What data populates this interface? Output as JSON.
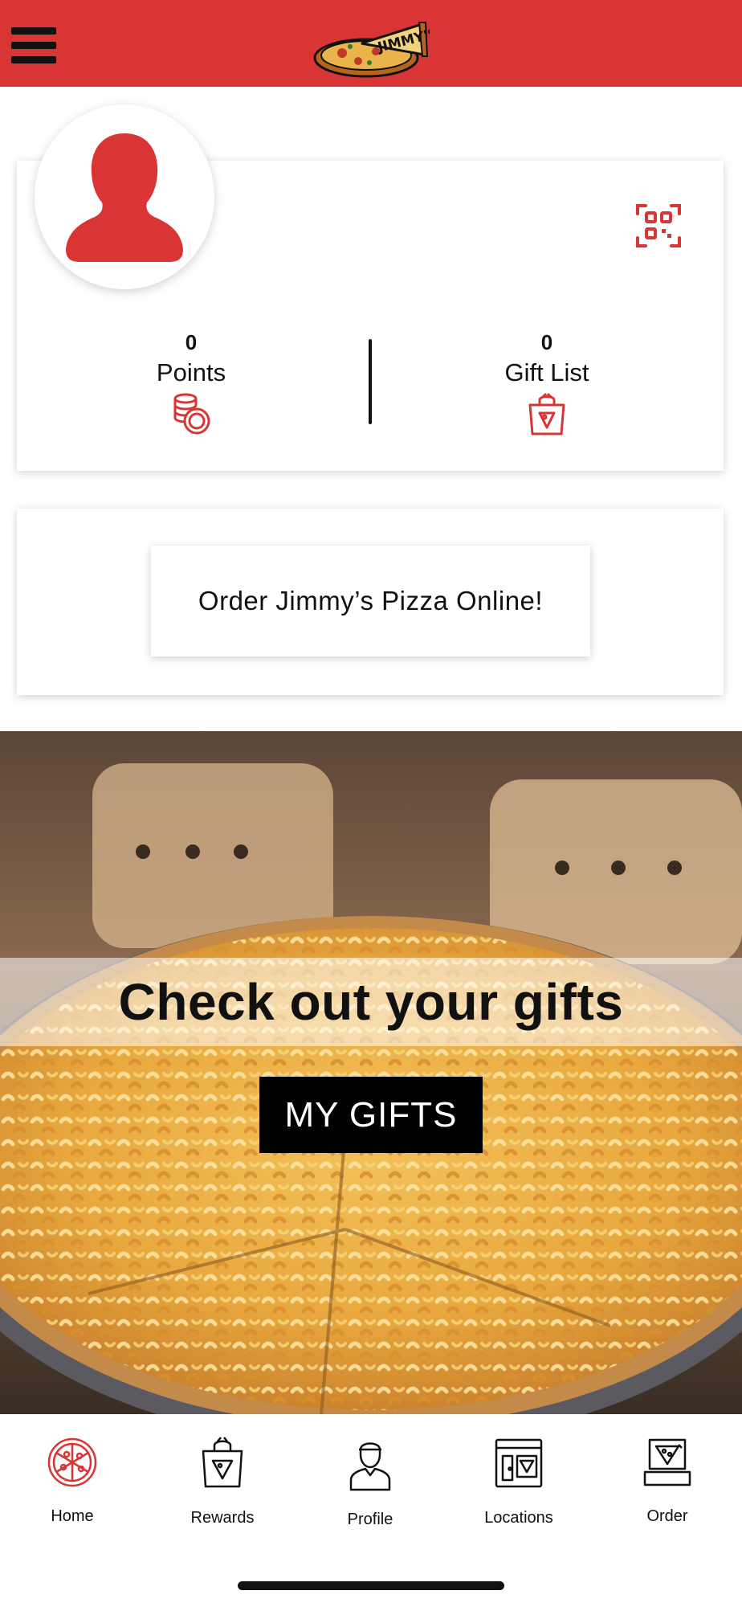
{
  "header": {
    "logo_text": "JIMMY'S",
    "accent_color": "#d93535"
  },
  "profile": {
    "points_value": "0",
    "points_label": "Points",
    "gifts_value": "0",
    "gifts_label": "Gift List"
  },
  "order": {
    "button_label": "Order Jimmy’s Pizza Online!"
  },
  "banner": {
    "title": "Check out your gifts",
    "button_label": "MY GIFTS"
  },
  "nav": {
    "items": [
      {
        "label": "Home",
        "icon": "pizza-icon",
        "active": true
      },
      {
        "label": "Rewards",
        "icon": "gift-bag-icon"
      },
      {
        "label": "Profile",
        "icon": "person-icon"
      },
      {
        "label": "Locations",
        "icon": "store-icon"
      },
      {
        "label": "Order",
        "icon": "pizza-box-icon"
      }
    ]
  }
}
